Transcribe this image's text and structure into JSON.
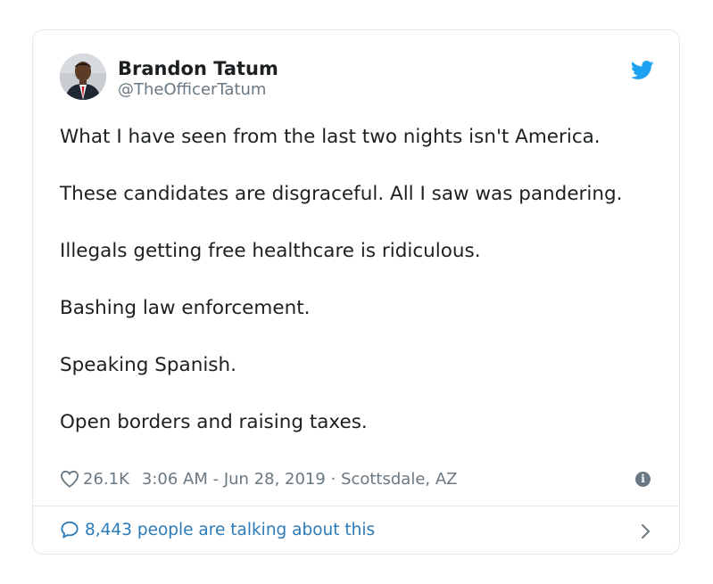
{
  "author": {
    "display_name": "Brandon Tatum",
    "handle": "@TheOfficerTatum",
    "avatar_icon": "avatar-photo"
  },
  "brand_icon": "twitter-bird-icon",
  "tweet": {
    "paragraphs": [
      "What I have seen from the last two nights isn't America.",
      "These candidates are disgraceful. All I saw was pandering.",
      "Illegals getting free healthcare is ridiculous.",
      "Bashing law enforcement.",
      "Speaking Spanish.",
      "Open borders and raising taxes."
    ]
  },
  "meta": {
    "likes": "26.1K",
    "timestamp": "3:06 AM - Jun 28, 2019",
    "separator": "·",
    "location": "Scottsdale, AZ",
    "info_icon_glyph": "i"
  },
  "footer": {
    "talking_label": "8,443 people are talking about this"
  },
  "colors": {
    "twitter_blue": "#1da1f2",
    "link_blue": "#2b7bb9",
    "muted_gray": "#697882",
    "border": "#e1e8ed"
  }
}
